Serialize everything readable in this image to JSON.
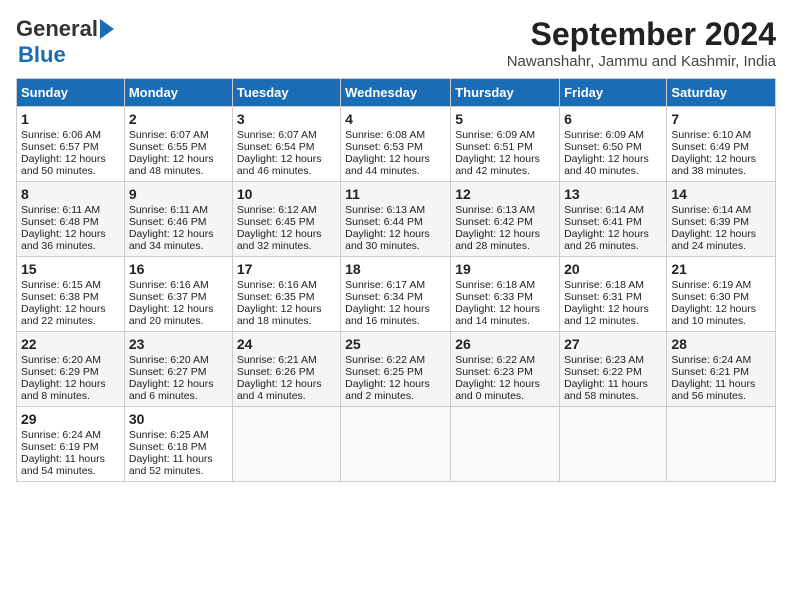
{
  "logo": {
    "text1": "General",
    "text2": "Blue"
  },
  "title": "September 2024",
  "subtitle": "Nawanshahr, Jammu and Kashmir, India",
  "days_header": [
    "Sunday",
    "Monday",
    "Tuesday",
    "Wednesday",
    "Thursday",
    "Friday",
    "Saturday"
  ],
  "weeks": [
    [
      {
        "day": 1,
        "rise": "6:06 AM",
        "set": "6:57 PM",
        "daylight": "12 hours and 50 minutes."
      },
      {
        "day": 2,
        "rise": "6:07 AM",
        "set": "6:55 PM",
        "daylight": "12 hours and 48 minutes."
      },
      {
        "day": 3,
        "rise": "6:07 AM",
        "set": "6:54 PM",
        "daylight": "12 hours and 46 minutes."
      },
      {
        "day": 4,
        "rise": "6:08 AM",
        "set": "6:53 PM",
        "daylight": "12 hours and 44 minutes."
      },
      {
        "day": 5,
        "rise": "6:09 AM",
        "set": "6:51 PM",
        "daylight": "12 hours and 42 minutes."
      },
      {
        "day": 6,
        "rise": "6:09 AM",
        "set": "6:50 PM",
        "daylight": "12 hours and 40 minutes."
      },
      {
        "day": 7,
        "rise": "6:10 AM",
        "set": "6:49 PM",
        "daylight": "12 hours and 38 minutes."
      }
    ],
    [
      {
        "day": 8,
        "rise": "6:11 AM",
        "set": "6:48 PM",
        "daylight": "12 hours and 36 minutes."
      },
      {
        "day": 9,
        "rise": "6:11 AM",
        "set": "6:46 PM",
        "daylight": "12 hours and 34 minutes."
      },
      {
        "day": 10,
        "rise": "6:12 AM",
        "set": "6:45 PM",
        "daylight": "12 hours and 32 minutes."
      },
      {
        "day": 11,
        "rise": "6:13 AM",
        "set": "6:44 PM",
        "daylight": "12 hours and 30 minutes."
      },
      {
        "day": 12,
        "rise": "6:13 AM",
        "set": "6:42 PM",
        "daylight": "12 hours and 28 minutes."
      },
      {
        "day": 13,
        "rise": "6:14 AM",
        "set": "6:41 PM",
        "daylight": "12 hours and 26 minutes."
      },
      {
        "day": 14,
        "rise": "6:14 AM",
        "set": "6:39 PM",
        "daylight": "12 hours and 24 minutes."
      }
    ],
    [
      {
        "day": 15,
        "rise": "6:15 AM",
        "set": "6:38 PM",
        "daylight": "12 hours and 22 minutes."
      },
      {
        "day": 16,
        "rise": "6:16 AM",
        "set": "6:37 PM",
        "daylight": "12 hours and 20 minutes."
      },
      {
        "day": 17,
        "rise": "6:16 AM",
        "set": "6:35 PM",
        "daylight": "12 hours and 18 minutes."
      },
      {
        "day": 18,
        "rise": "6:17 AM",
        "set": "6:34 PM",
        "daylight": "12 hours and 16 minutes."
      },
      {
        "day": 19,
        "rise": "6:18 AM",
        "set": "6:33 PM",
        "daylight": "12 hours and 14 minutes."
      },
      {
        "day": 20,
        "rise": "6:18 AM",
        "set": "6:31 PM",
        "daylight": "12 hours and 12 minutes."
      },
      {
        "day": 21,
        "rise": "6:19 AM",
        "set": "6:30 PM",
        "daylight": "12 hours and 10 minutes."
      }
    ],
    [
      {
        "day": 22,
        "rise": "6:20 AM",
        "set": "6:29 PM",
        "daylight": "12 hours and 8 minutes."
      },
      {
        "day": 23,
        "rise": "6:20 AM",
        "set": "6:27 PM",
        "daylight": "12 hours and 6 minutes."
      },
      {
        "day": 24,
        "rise": "6:21 AM",
        "set": "6:26 PM",
        "daylight": "12 hours and 4 minutes."
      },
      {
        "day": 25,
        "rise": "6:22 AM",
        "set": "6:25 PM",
        "daylight": "12 hours and 2 minutes."
      },
      {
        "day": 26,
        "rise": "6:22 AM",
        "set": "6:23 PM",
        "daylight": "12 hours and 0 minutes."
      },
      {
        "day": 27,
        "rise": "6:23 AM",
        "set": "6:22 PM",
        "daylight": "11 hours and 58 minutes."
      },
      {
        "day": 28,
        "rise": "6:24 AM",
        "set": "6:21 PM",
        "daylight": "11 hours and 56 minutes."
      }
    ],
    [
      {
        "day": 29,
        "rise": "6:24 AM",
        "set": "6:19 PM",
        "daylight": "11 hours and 54 minutes."
      },
      {
        "day": 30,
        "rise": "6:25 AM",
        "set": "6:18 PM",
        "daylight": "11 hours and 52 minutes."
      },
      null,
      null,
      null,
      null,
      null
    ]
  ]
}
